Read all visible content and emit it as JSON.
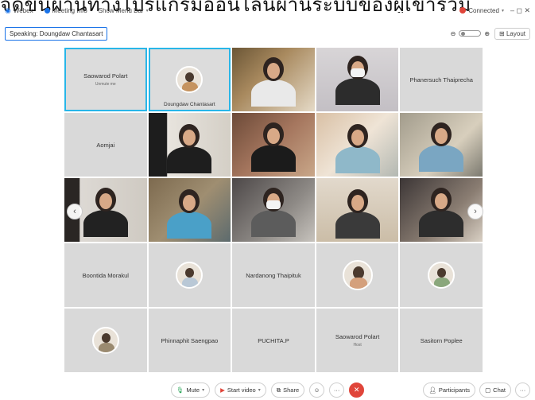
{
  "overlay_caption": "จัดขึ้นผ่านทางโปรแกรมออนไลน์ผ่านระบบของผู้เข้าร่วม",
  "titlebar": {
    "app_name": "Webex",
    "meeting_info": "Meeting Info",
    "show_menu_bar": "Show Menu Bar",
    "connected": "Connected",
    "window_controls": "–   ◻   ✕"
  },
  "topbar": {
    "speaking": "Speaking: Doungdaw Chantasart",
    "zoom_minus": "⊖",
    "zoom_plus": "⊕",
    "layout": "Layout"
  },
  "tiles": {
    "r1c1": {
      "name": "Saowarod Polart",
      "sub": "Unmute me"
    },
    "r1c2": {
      "name": "Doungdaw Chantasart"
    },
    "r1c5": {
      "name": "Phanersuch Thaiprecha"
    },
    "r2c1": {
      "name": "Aomjai"
    },
    "r4c1": {
      "name": "Boontida Morakul"
    },
    "r4c3": {
      "name": "Nardanong Thaipituk"
    },
    "r5c2": {
      "name": "Phinnaphit Saengpao"
    },
    "r5c3": {
      "name": "PUCHITA.P"
    },
    "r5c4": {
      "name": "Saowarod Polart",
      "sub": "Host"
    },
    "r5c5": {
      "name": "Sasitorn Poplee"
    }
  },
  "nav": {
    "left": "‹",
    "right": "›"
  },
  "controls": {
    "mute": "Mute",
    "start_video": "Start video",
    "share": "Share",
    "more": "···",
    "end": "✕",
    "participants": "Participants",
    "chat": "Chat",
    "overflow": "···"
  },
  "colors": {
    "accent": "#1a73e8",
    "active_outline": "#28b6e8",
    "end_red": "#e0453a",
    "tile_bg": "#d9d9d9"
  }
}
